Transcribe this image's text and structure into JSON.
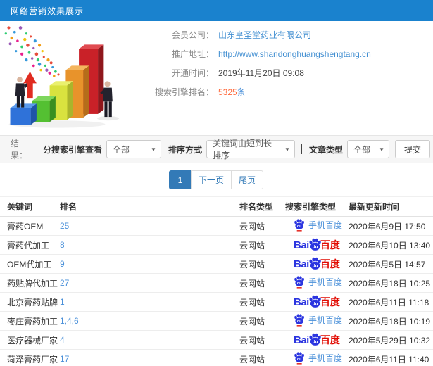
{
  "header": {
    "title": "网络营销效果展示"
  },
  "info": {
    "member_label": "会员公司：",
    "member_value": "山东皇圣堂药业有限公司",
    "url_label": "推广地址：",
    "url_value": "http://www.shandonghuangshengtang.cn",
    "open_label": "开通时间：",
    "open_value": "2019年11月20日 09:08",
    "rank_label": "搜索引擎排名：",
    "rank_count": "5325",
    "rank_unit": "条"
  },
  "filters": {
    "result_label": "结果：",
    "engine_filter_label": "分搜索引擎查看",
    "engine_filter_value": "全部",
    "sort_label": "排序方式",
    "sort_value": "关键词由短到长排序",
    "article_type_label": "文章类型",
    "article_type_value": "全部",
    "submit_label": "提交",
    "caret": "▼"
  },
  "pagination": {
    "current": "1",
    "next_label": "下一页",
    "last_label": "尾页"
  },
  "table": {
    "headers": [
      "关键词",
      "排名",
      "排名类型",
      "搜索引擎类型",
      "最新更新时间"
    ],
    "engine_labels": {
      "mobile_baidu": "手机百度",
      "baidu_bai": "Bai",
      "baidu_du": "du",
      "baidu_cn": "百度"
    },
    "rows": [
      {
        "keyword": "膏药OEM",
        "rank": "25",
        "rank_type": "云网站",
        "engine": "mobile_baidu",
        "updated": "2020年6月9日 17:50"
      },
      {
        "keyword": "膏药代加工",
        "rank": "8",
        "rank_type": "云网站",
        "engine": "baidu",
        "updated": "2020年6月10日 13:40"
      },
      {
        "keyword": "OEM代加工",
        "rank": "9",
        "rank_type": "云网站",
        "engine": "baidu",
        "updated": "2020年6月5日 14:57"
      },
      {
        "keyword": "药贴牌代加工",
        "rank": "27",
        "rank_type": "云网站",
        "engine": "mobile_baidu",
        "updated": "2020年6月18日 10:25"
      },
      {
        "keyword": "北京膏药贴牌",
        "rank": "1",
        "rank_type": "云网站",
        "engine": "baidu",
        "updated": "2020年6月11日 11:18"
      },
      {
        "keyword": "枣庄膏药加工",
        "rank": "1,4,6",
        "rank_type": "云网站",
        "engine": "mobile_baidu",
        "updated": "2020年6月18日 10:19"
      },
      {
        "keyword": "医疗器械厂家",
        "rank": "4",
        "rank_type": "云网站",
        "engine": "baidu",
        "updated": "2020年5月29日 10:32"
      },
      {
        "keyword": "菏泽膏药厂家",
        "rank": "17",
        "rank_type": "云网站",
        "engine": "mobile_baidu",
        "updated": "2020年6月11日 11:40"
      }
    ]
  },
  "colors": {
    "header_bg": "#1a82ce",
    "link_blue": "#4490d2",
    "accent_orange": "#ff6a3c",
    "baidu_blue": "#2b35e0",
    "baidu_red": "#e10900",
    "pagination_active": "#337ab7"
  }
}
